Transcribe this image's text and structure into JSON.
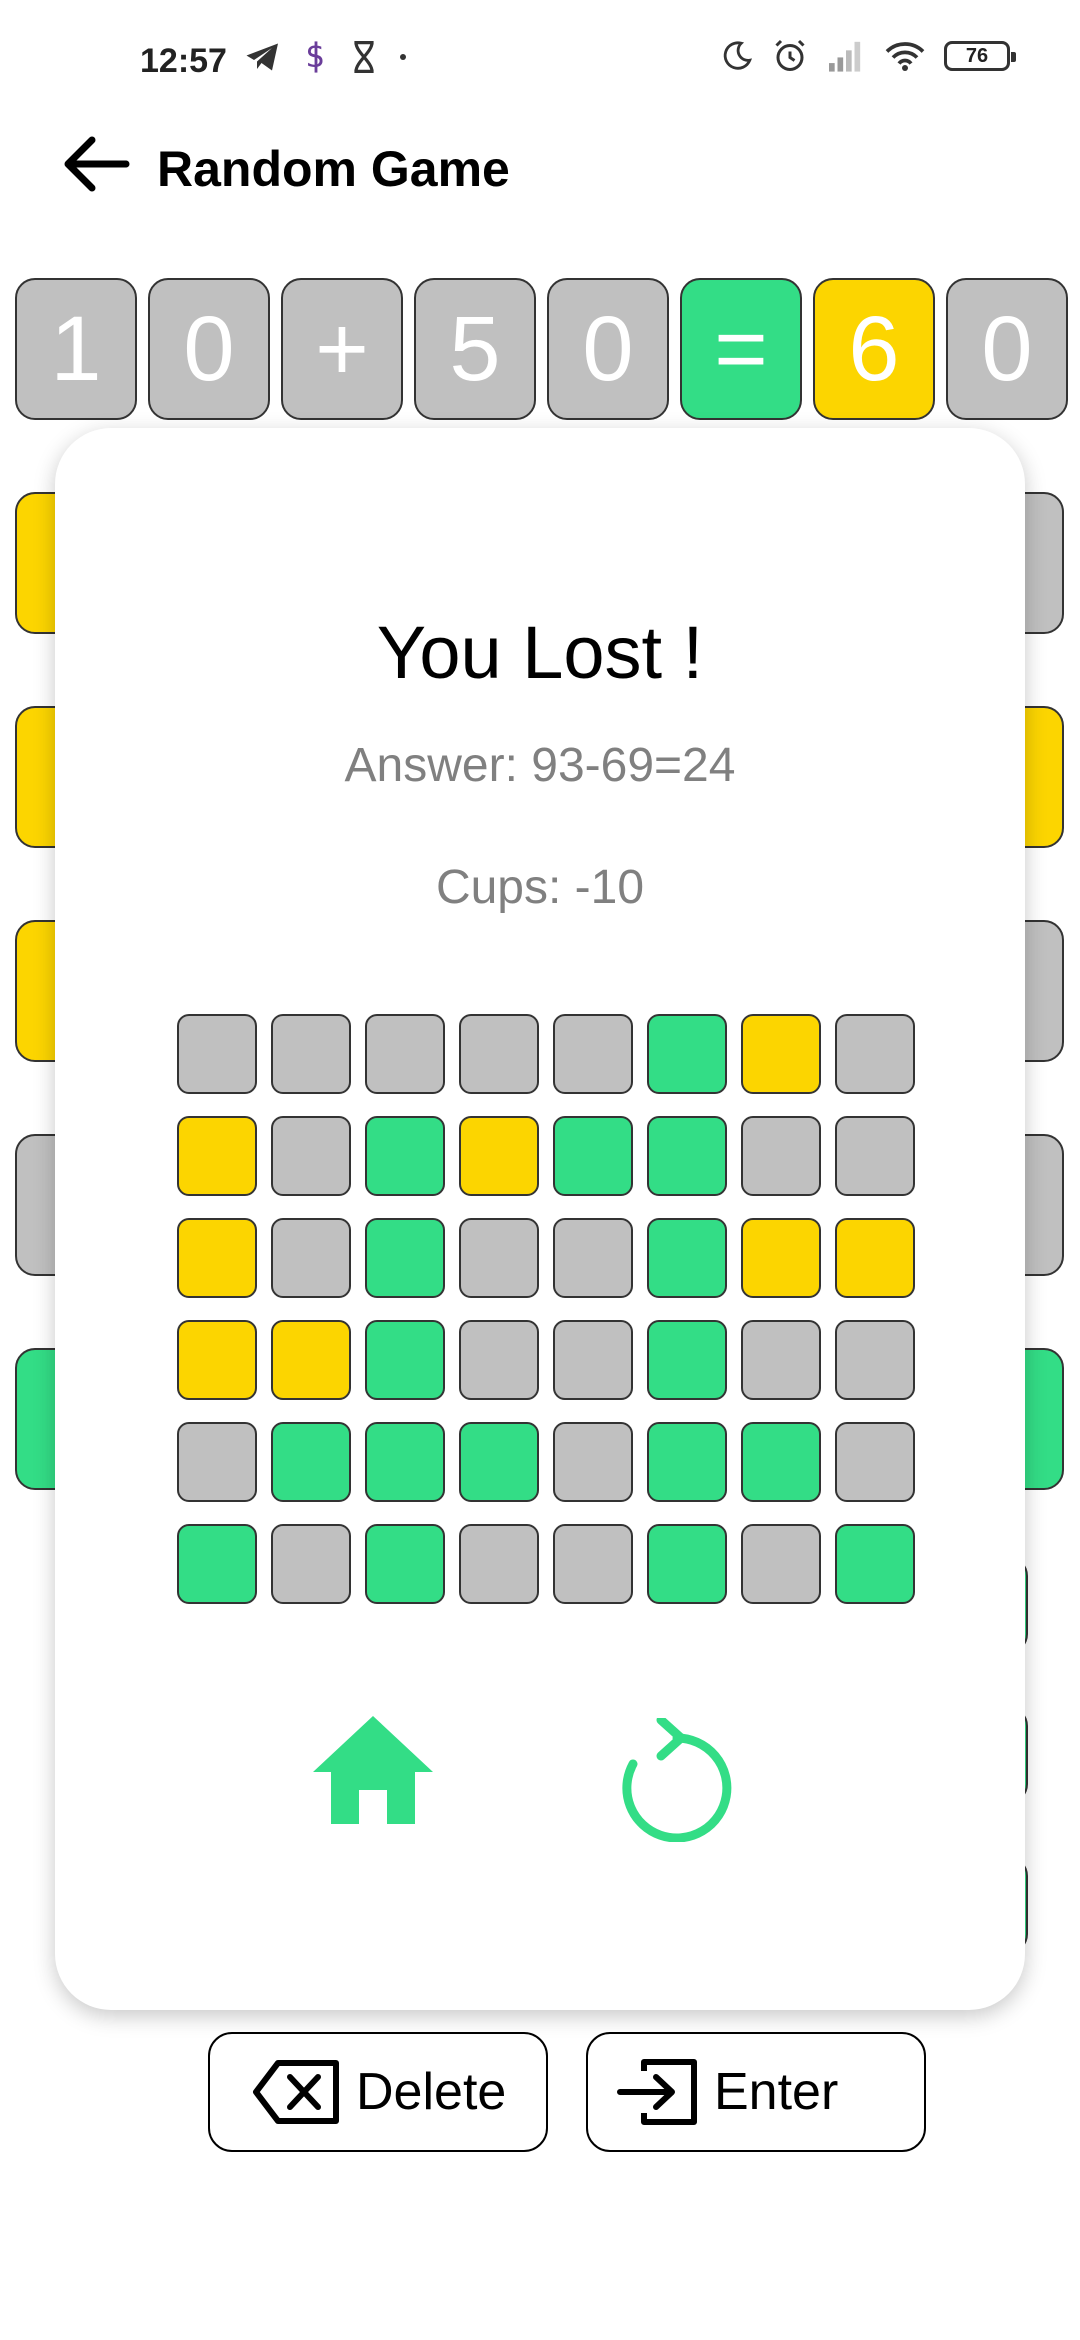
{
  "status_bar": {
    "time": "12:57",
    "left_icons": [
      "telegram-icon",
      "s-app-icon",
      "hourglass-icon",
      "dot-icon"
    ],
    "right_icons": [
      "moon-icon",
      "alarm-icon",
      "signal-icon",
      "wifi-icon"
    ],
    "battery": "76"
  },
  "header": {
    "title": "Random Game",
    "back_icon": "arrow-left-icon"
  },
  "colors": {
    "gray": "#c0c0c0",
    "yellow": "#fcd500",
    "green": "#33dd86"
  },
  "board": {
    "top_row": [
      {
        "char": "1",
        "state": "gray"
      },
      {
        "char": "0",
        "state": "gray"
      },
      {
        "char": "+",
        "state": "gray"
      },
      {
        "char": "5",
        "state": "gray"
      },
      {
        "char": "0",
        "state": "gray"
      },
      {
        "char": "=",
        "state": "green"
      },
      {
        "char": "6",
        "state": "yellow"
      },
      {
        "char": "0",
        "state": "gray"
      }
    ]
  },
  "modal": {
    "title": "You Lost !",
    "answer": "Answer: 93-69=24",
    "cups": "Cups: -10",
    "grid": [
      [
        "gray",
        "gray",
        "gray",
        "gray",
        "gray",
        "green",
        "yellow",
        "gray"
      ],
      [
        "yellow",
        "gray",
        "green",
        "yellow",
        "green",
        "green",
        "gray",
        "gray"
      ],
      [
        "yellow",
        "gray",
        "green",
        "gray",
        "gray",
        "green",
        "yellow",
        "yellow"
      ],
      [
        "yellow",
        "yellow",
        "green",
        "gray",
        "gray",
        "green",
        "gray",
        "gray"
      ],
      [
        "gray",
        "green",
        "green",
        "green",
        "gray",
        "green",
        "green",
        "gray"
      ],
      [
        "green",
        "gray",
        "green",
        "gray",
        "gray",
        "green",
        "gray",
        "green"
      ]
    ],
    "home_icon": "home-icon",
    "restart_icon": "refresh-icon"
  },
  "keys": {
    "delete_label": "Delete",
    "enter_label": "Enter"
  }
}
